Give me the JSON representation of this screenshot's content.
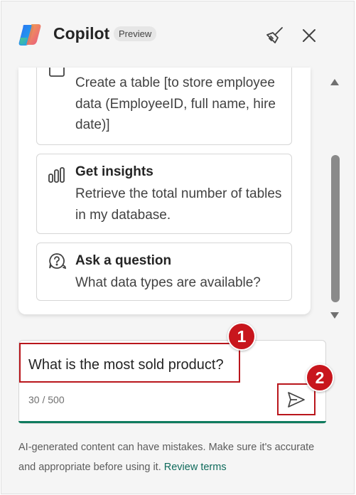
{
  "header": {
    "title": "Copilot",
    "badge": "Preview",
    "icons": [
      "copilot-logo",
      "broom-icon",
      "close-icon"
    ]
  },
  "prompts": [
    {
      "icon": "table-icon",
      "title": "",
      "description": "Create a table [to store employee data (EmployeeID, full name, hire date)]"
    },
    {
      "icon": "bar-chart-icon",
      "title": "Get insights",
      "description": "Retrieve the total number of tables in my database."
    },
    {
      "icon": "question-chat-icon",
      "title": "Ask a question",
      "description": "What data types are available?"
    }
  ],
  "input": {
    "value": "What is the most sold product?",
    "char_count": "30 / 500"
  },
  "markers": [
    "1",
    "2"
  ],
  "footer": {
    "disclaimer": "AI-generated content can have mistakes. Make sure it's accurate and appropriate before using it.",
    "link": "Review terms"
  },
  "colors": {
    "accent": "#0f7b5e",
    "marker": "#c8161d",
    "panel_bg": "#f5f5f5"
  }
}
